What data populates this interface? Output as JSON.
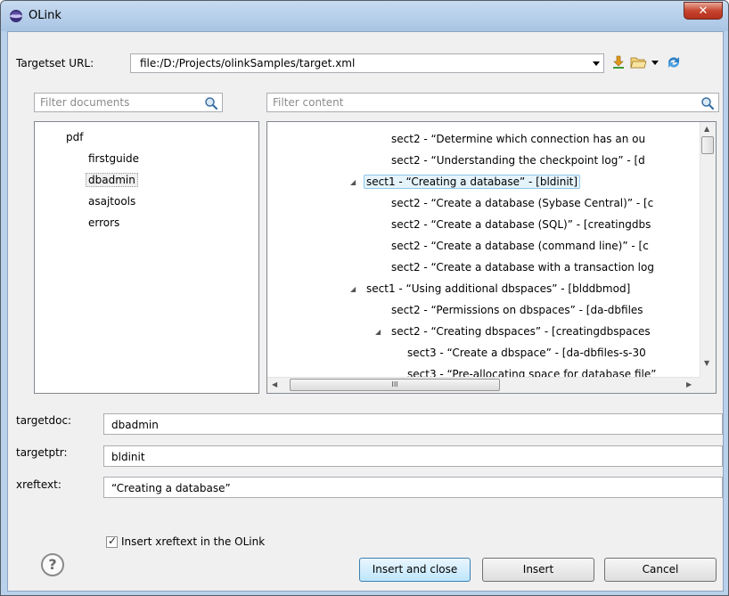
{
  "window": {
    "title": "OLink"
  },
  "targetset": {
    "label": "Targetset URL:",
    "value": "file:/D:/Projects/olinkSamples/target.xml"
  },
  "toolbar_icons": [
    "download-icon",
    "folder-open-icon",
    "dropdown-arrow-icon",
    "refresh-icon"
  ],
  "filter_documents": {
    "placeholder": "Filter documents"
  },
  "filter_content": {
    "placeholder": "Filter content"
  },
  "documents": {
    "root": "pdf",
    "children": [
      "firstguide",
      "dbadmin",
      "asajtools",
      "errors"
    ],
    "selected": "dbadmin"
  },
  "content_tree": [
    {
      "text": "sect2 - “Determine which connection has an ou",
      "expander": ""
    },
    {
      "text": "sect2 - “Understanding the checkpoint log” - [d",
      "expander": ""
    },
    {
      "text": "sect1 - “Creating a database” - [bldinit]",
      "expander": "◢",
      "selected": true
    },
    {
      "text": "sect2 - “Create a database (Sybase Central)” - [c",
      "expander": ""
    },
    {
      "text": "sect2 - “Create a database (SQL)” - [creatingdbs",
      "expander": ""
    },
    {
      "text": "sect2 - “Create a database (command line)” - [c",
      "expander": ""
    },
    {
      "text": "sect2 - “Create a database with a transaction log",
      "expander": ""
    },
    {
      "text": "sect1 - “Using additional dbspaces” - [blddbmod]",
      "expander": "◢"
    },
    {
      "text": "sect2 - “Permissions on dbspaces” - [da-dbfiles",
      "expander": ""
    },
    {
      "text": "sect2 - “Creating dbspaces” - [creatingdbspaces",
      "expander": "◢"
    },
    {
      "text": "sect3 - “Create a dbspace” - [da-dbfiles-s-30",
      "expander": ""
    },
    {
      "text": "sect3 - “Pre-allocating space for database file”",
      "expander": ""
    }
  ],
  "scrollbar": {
    "h_thumb_grip": "III"
  },
  "fields": {
    "targetdoc": {
      "label": "targetdoc:",
      "value": "dbadmin"
    },
    "targetptr": {
      "label": "targetptr:",
      "value": "bldinit"
    },
    "xreftext": {
      "label": "xreftext:",
      "value": "“Creating a database”"
    }
  },
  "insert_xreftext": {
    "label": "Insert xreftext in the OLink",
    "checked": true
  },
  "buttons": {
    "insert_and_close": "Insert and close",
    "insert": "Insert",
    "cancel": "Cancel"
  },
  "help": {
    "glyph": "?"
  },
  "colors": {
    "titlebar": "#b9d1ea",
    "close": "#c7452f",
    "selection": "#e5f3fb",
    "default_button": "#bee6fd"
  }
}
